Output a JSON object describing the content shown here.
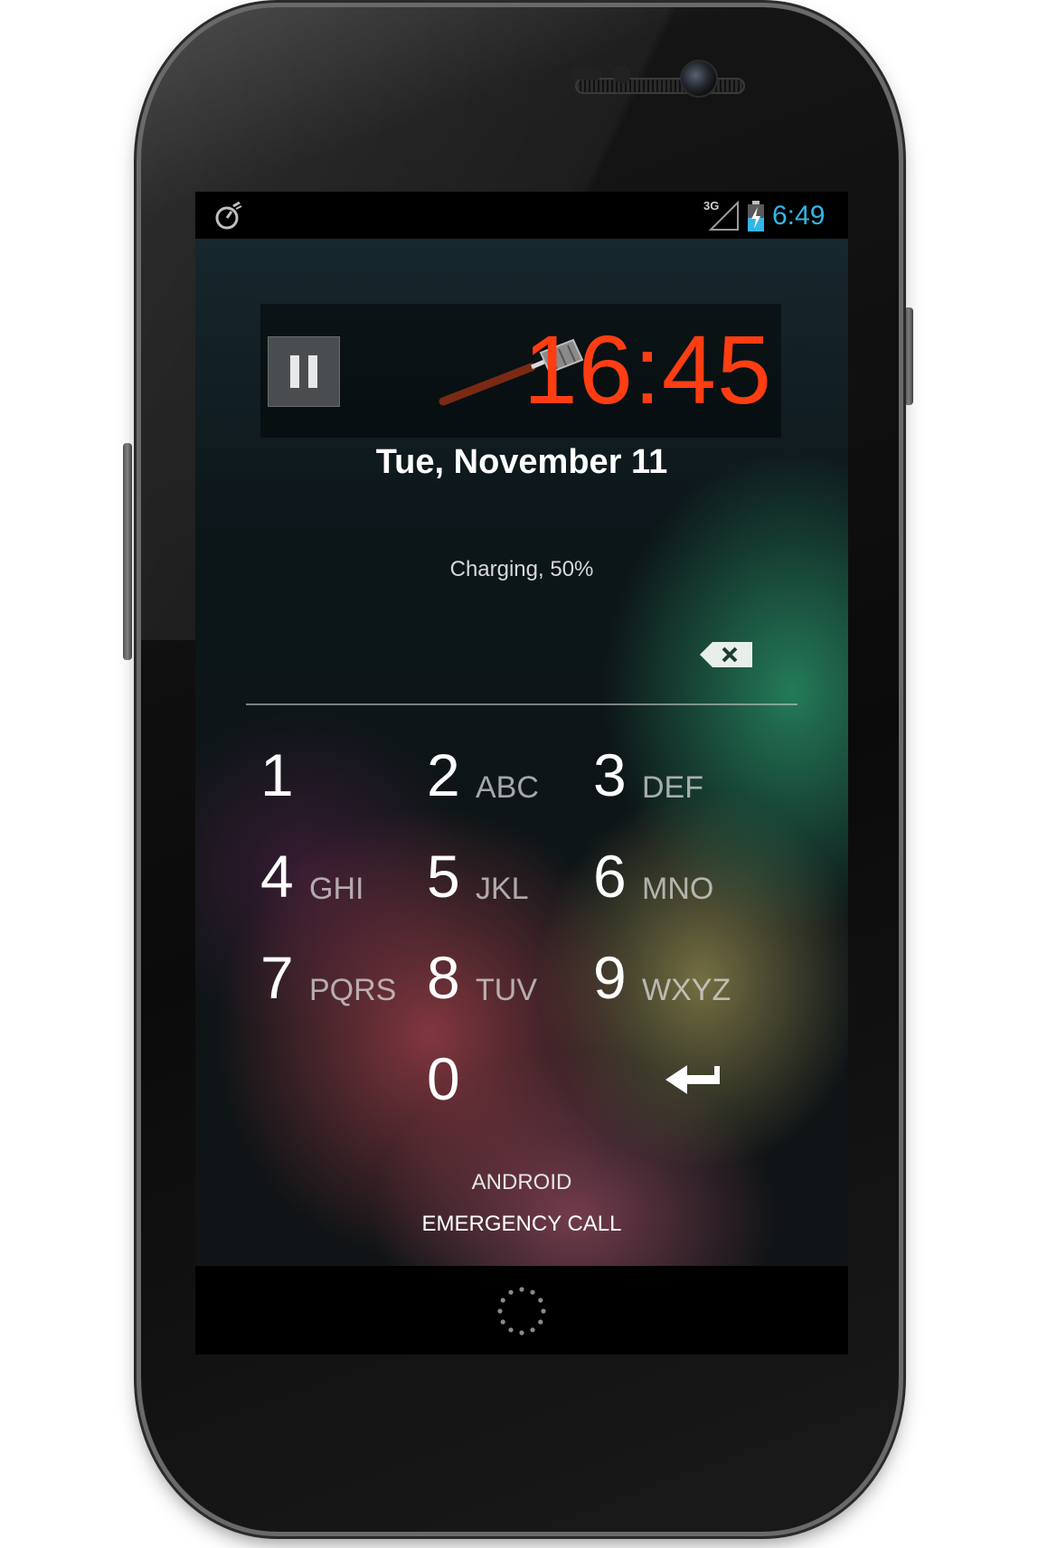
{
  "status_bar": {
    "left_icon": "stopwatch-icon",
    "network_label": "3G",
    "signal_icon": "signal-icon",
    "battery_icon": "battery-charging-icon",
    "time": "6:49",
    "time_color": "#33b5e5"
  },
  "widget": {
    "pause_icon": "pause-icon",
    "decoration_icon": "spatula-icon",
    "timer": "16:45",
    "timer_color": "#ff3d12"
  },
  "lockscreen": {
    "date": "Tue, November 11",
    "charging": "Charging, 50%",
    "backspace_icon": "backspace-icon",
    "carrier": "ANDROID",
    "emergency": "EMERGENCY CALL"
  },
  "keypad": {
    "keys": [
      {
        "digit": "1",
        "letters": ""
      },
      {
        "digit": "2",
        "letters": "ABC"
      },
      {
        "digit": "3",
        "letters": "DEF"
      },
      {
        "digit": "4",
        "letters": "GHI"
      },
      {
        "digit": "5",
        "letters": "JKL"
      },
      {
        "digit": "6",
        "letters": "MNO"
      },
      {
        "digit": "7",
        "letters": "PQRS"
      },
      {
        "digit": "8",
        "letters": "TUV"
      },
      {
        "digit": "9",
        "letters": "WXYZ"
      },
      {
        "digit": "0",
        "letters": ""
      }
    ],
    "enter_icon": "enter-arrow-icon"
  },
  "navigation": {
    "home_icon": "home-ring-icon"
  }
}
